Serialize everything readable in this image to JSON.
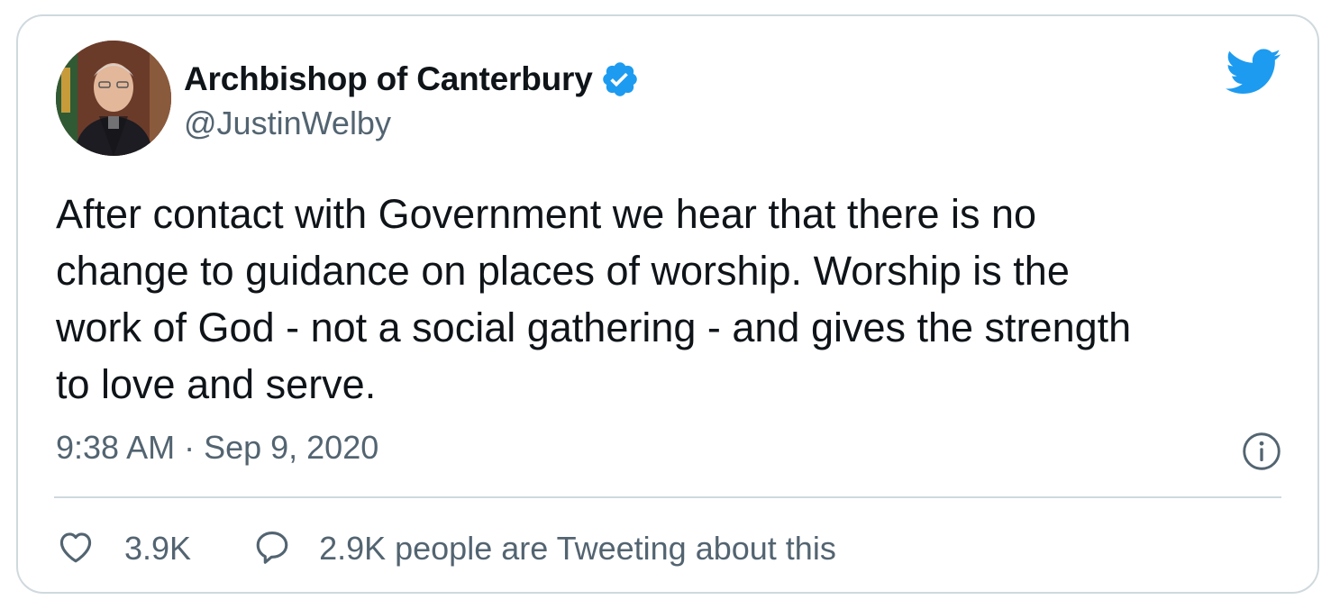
{
  "author": {
    "display_name": "Archbishop of Canterbury",
    "handle": "@JustinWelby",
    "verified": true
  },
  "tweet": {
    "text": "After contact with Government we hear that there is no\nchange to guidance on places of worship. Worship is the\nwork of God - not a social gathering - and gives the strength\nto love and serve.",
    "timestamp": "9:38 AM · Sep 9, 2020"
  },
  "actions": {
    "likes": "3.9K",
    "tweeting": "2.9K people are Tweeting about this"
  },
  "icons": {
    "brand": "twitter-bird-icon",
    "verified": "verified-badge-icon",
    "info": "info-icon",
    "like": "heart-icon",
    "reply": "speech-bubble-icon"
  },
  "colors": {
    "brand": "#1d9bf0",
    "text_primary": "#0f1419",
    "text_secondary": "#536471",
    "border": "#cfd9de"
  }
}
